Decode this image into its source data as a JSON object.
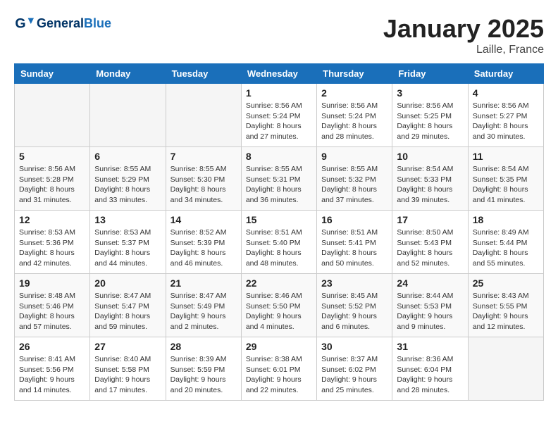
{
  "header": {
    "logo_general": "General",
    "logo_blue": "Blue",
    "month": "January 2025",
    "location": "Laille, France"
  },
  "weekdays": [
    "Sunday",
    "Monday",
    "Tuesday",
    "Wednesday",
    "Thursday",
    "Friday",
    "Saturday"
  ],
  "weeks": [
    [
      {
        "day": "",
        "info": ""
      },
      {
        "day": "",
        "info": ""
      },
      {
        "day": "",
        "info": ""
      },
      {
        "day": "1",
        "info": "Sunrise: 8:56 AM\nSunset: 5:24 PM\nDaylight: 8 hours\nand 27 minutes."
      },
      {
        "day": "2",
        "info": "Sunrise: 8:56 AM\nSunset: 5:24 PM\nDaylight: 8 hours\nand 28 minutes."
      },
      {
        "day": "3",
        "info": "Sunrise: 8:56 AM\nSunset: 5:25 PM\nDaylight: 8 hours\nand 29 minutes."
      },
      {
        "day": "4",
        "info": "Sunrise: 8:56 AM\nSunset: 5:27 PM\nDaylight: 8 hours\nand 30 minutes."
      }
    ],
    [
      {
        "day": "5",
        "info": "Sunrise: 8:56 AM\nSunset: 5:28 PM\nDaylight: 8 hours\nand 31 minutes."
      },
      {
        "day": "6",
        "info": "Sunrise: 8:55 AM\nSunset: 5:29 PM\nDaylight: 8 hours\nand 33 minutes."
      },
      {
        "day": "7",
        "info": "Sunrise: 8:55 AM\nSunset: 5:30 PM\nDaylight: 8 hours\nand 34 minutes."
      },
      {
        "day": "8",
        "info": "Sunrise: 8:55 AM\nSunset: 5:31 PM\nDaylight: 8 hours\nand 36 minutes."
      },
      {
        "day": "9",
        "info": "Sunrise: 8:55 AM\nSunset: 5:32 PM\nDaylight: 8 hours\nand 37 minutes."
      },
      {
        "day": "10",
        "info": "Sunrise: 8:54 AM\nSunset: 5:33 PM\nDaylight: 8 hours\nand 39 minutes."
      },
      {
        "day": "11",
        "info": "Sunrise: 8:54 AM\nSunset: 5:35 PM\nDaylight: 8 hours\nand 41 minutes."
      }
    ],
    [
      {
        "day": "12",
        "info": "Sunrise: 8:53 AM\nSunset: 5:36 PM\nDaylight: 8 hours\nand 42 minutes."
      },
      {
        "day": "13",
        "info": "Sunrise: 8:53 AM\nSunset: 5:37 PM\nDaylight: 8 hours\nand 44 minutes."
      },
      {
        "day": "14",
        "info": "Sunrise: 8:52 AM\nSunset: 5:39 PM\nDaylight: 8 hours\nand 46 minutes."
      },
      {
        "day": "15",
        "info": "Sunrise: 8:51 AM\nSunset: 5:40 PM\nDaylight: 8 hours\nand 48 minutes."
      },
      {
        "day": "16",
        "info": "Sunrise: 8:51 AM\nSunset: 5:41 PM\nDaylight: 8 hours\nand 50 minutes."
      },
      {
        "day": "17",
        "info": "Sunrise: 8:50 AM\nSunset: 5:43 PM\nDaylight: 8 hours\nand 52 minutes."
      },
      {
        "day": "18",
        "info": "Sunrise: 8:49 AM\nSunset: 5:44 PM\nDaylight: 8 hours\nand 55 minutes."
      }
    ],
    [
      {
        "day": "19",
        "info": "Sunrise: 8:48 AM\nSunset: 5:46 PM\nDaylight: 8 hours\nand 57 minutes."
      },
      {
        "day": "20",
        "info": "Sunrise: 8:47 AM\nSunset: 5:47 PM\nDaylight: 8 hours\nand 59 minutes."
      },
      {
        "day": "21",
        "info": "Sunrise: 8:47 AM\nSunset: 5:49 PM\nDaylight: 9 hours\nand 2 minutes."
      },
      {
        "day": "22",
        "info": "Sunrise: 8:46 AM\nSunset: 5:50 PM\nDaylight: 9 hours\nand 4 minutes."
      },
      {
        "day": "23",
        "info": "Sunrise: 8:45 AM\nSunset: 5:52 PM\nDaylight: 9 hours\nand 6 minutes."
      },
      {
        "day": "24",
        "info": "Sunrise: 8:44 AM\nSunset: 5:53 PM\nDaylight: 9 hours\nand 9 minutes."
      },
      {
        "day": "25",
        "info": "Sunrise: 8:43 AM\nSunset: 5:55 PM\nDaylight: 9 hours\nand 12 minutes."
      }
    ],
    [
      {
        "day": "26",
        "info": "Sunrise: 8:41 AM\nSunset: 5:56 PM\nDaylight: 9 hours\nand 14 minutes."
      },
      {
        "day": "27",
        "info": "Sunrise: 8:40 AM\nSunset: 5:58 PM\nDaylight: 9 hours\nand 17 minutes."
      },
      {
        "day": "28",
        "info": "Sunrise: 8:39 AM\nSunset: 5:59 PM\nDaylight: 9 hours\nand 20 minutes."
      },
      {
        "day": "29",
        "info": "Sunrise: 8:38 AM\nSunset: 6:01 PM\nDaylight: 9 hours\nand 22 minutes."
      },
      {
        "day": "30",
        "info": "Sunrise: 8:37 AM\nSunset: 6:02 PM\nDaylight: 9 hours\nand 25 minutes."
      },
      {
        "day": "31",
        "info": "Sunrise: 8:36 AM\nSunset: 6:04 PM\nDaylight: 9 hours\nand 28 minutes."
      },
      {
        "day": "",
        "info": ""
      }
    ]
  ]
}
